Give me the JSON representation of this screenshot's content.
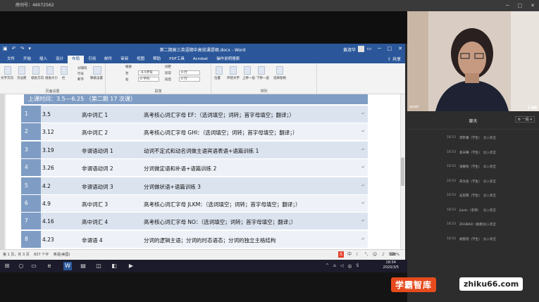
{
  "topbar": {
    "room_text": "房间号：46072562"
  },
  "word": {
    "title": "第二期高三英语期中高效课提纲.docx - Word",
    "user": "黄淑华",
    "tabs": [
      "文件",
      "开始",
      "插入",
      "设计",
      "布局",
      "引用",
      "邮件",
      "审阅",
      "视图",
      "帮助",
      "PDF工具",
      "Acrobat",
      "操作说明搜索"
    ],
    "active_tab": "布局",
    "share": "共享",
    "ribbon": {
      "groups": [
        "页面设置",
        "段落",
        "排列"
      ],
      "indent_label": "缩进",
      "spacing_label": "间距",
      "left_label": "左",
      "right_label": "右",
      "before_label": "段前",
      "after_label": "段后",
      "left_value": "-6.5字符",
      "right_value": "0 字符",
      "before_value": "0 行",
      "after_value": "0 行",
      "btn_labels": [
        "文字方向",
        "页边距",
        "纸张方向",
        "纸张大小",
        "栏",
        "分隔符",
        "行号",
        "断字",
        "稿纸设置",
        "位置",
        "环绕文字",
        "上移一层",
        "下移一层",
        "选择窗格"
      ]
    },
    "doc_header": "上课时间：3.5---6.25   （第二期 17 次课）",
    "rows": [
      {
        "num": "1",
        "date": "3.5",
        "cat": "高中词汇 1",
        "desc": "高考核心词汇字母 EF：（选词填空；词转；首字母填空；翻译；）"
      },
      {
        "num": "2",
        "date": "3.12",
        "cat": "高中词汇 2",
        "desc": "高考核心词汇字母 GHI：（选词填空；词转；首字母填空；翻译；）"
      },
      {
        "num": "3",
        "date": "3.19",
        "cat": "非谓语动词 1",
        "desc": "动词不定式和动名词做主语宾语表语+语篇训练 1"
      },
      {
        "num": "4",
        "date": "3.26",
        "cat": "非谓语动词 2",
        "desc": "分词做定语和补语+语篇训练 2"
      },
      {
        "num": "5",
        "date": "4.2",
        "cat": "非谓语动词 3",
        "desc": "分词做状语+语篇训练 3"
      },
      {
        "num": "6",
        "date": "4.9",
        "cat": "高中词汇 3",
        "desc": "高考核心词汇字母 JLKM：（选词填空；词转；首字母填空；翻译；）"
      },
      {
        "num": "7",
        "date": "4.16",
        "cat": "高中词汇 4",
        "desc": "高考核心词汇字母 NO：（选词填空；词转；首字母填空；翻译；）"
      },
      {
        "num": "8",
        "date": "4.23",
        "cat": "非谓语 4",
        "desc": "分词的逻辑主语；分词的时态语态；分词的独立主格结构"
      }
    ],
    "status": {
      "page": "第 1 页，共 3 页",
      "words": "657 个字",
      "lang": "英语(美国)",
      "zoom": "100%"
    }
  },
  "taskbar": {
    "time": "18:54",
    "date": "2020/3/5",
    "ime": "中"
  },
  "video": {
    "name": "azuki"
  },
  "chat": {
    "title": "聊天",
    "option": "一般",
    "messages": [
      {
        "t": "18:53",
        "u": "李昕睿（学生）",
        "a": "加入教室"
      },
      {
        "t": "18:53",
        "u": "高天骞（学生）",
        "a": "加入教室"
      },
      {
        "t": "18:53",
        "u": "张静怡（学生）",
        "a": "加入教室"
      },
      {
        "t": "18:53",
        "u": "宋文迪（学生）",
        "a": "加入教室"
      },
      {
        "t": "18:53",
        "u": "吴思萌（学生）",
        "a": "加入教室"
      },
      {
        "t": "18:53",
        "u": "jiaxin（老师）",
        "a": "加入教室"
      },
      {
        "t": "18:53",
        "u": "ZHUBAO（助教）",
        "a": "加入教室"
      },
      {
        "t": "18:53",
        "u": "胡宸瑄（学生）",
        "a": "加入教室"
      }
    ]
  },
  "watermark": {
    "cn": "学霸智库",
    "url": "zhiku66.com"
  }
}
